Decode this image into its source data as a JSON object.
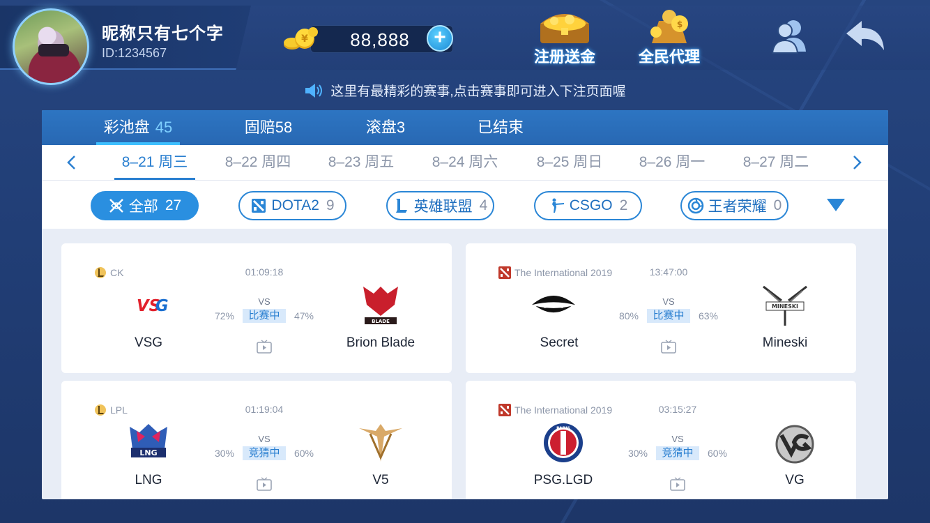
{
  "user": {
    "nickname": "昵称只有七个字",
    "id": "ID:1234567",
    "coins": "88,888"
  },
  "header": {
    "register_bonus_label": "注册送金",
    "agent_label": "全民代理"
  },
  "notice": {
    "text": "这里有最精彩的赛事,点击赛事即可进入下注页面喔"
  },
  "tabs": [
    {
      "label": "彩池盘",
      "count": "45"
    },
    {
      "label": "固赔58",
      "count": ""
    },
    {
      "label": "滚盘3",
      "count": ""
    },
    {
      "label": "已结束",
      "count": ""
    }
  ],
  "dates": [
    "8–21 周三",
    "8–22 周四",
    "8–23 周五",
    "8–24 周六",
    "8–25 周日",
    "8–26 周一",
    "8–27 周二"
  ],
  "games": [
    {
      "label": "全部",
      "count": "27",
      "icon": "crossed-swords-icon"
    },
    {
      "label": "DOTA2",
      "count": "9",
      "icon": "dota2-icon"
    },
    {
      "label": "英雄联盟",
      "count": "4",
      "icon": "lol-icon"
    },
    {
      "label": "CSGO",
      "count": "2",
      "icon": "csgo-icon"
    },
    {
      "label": "王者荣耀",
      "count": "0",
      "icon": "kog-icon"
    }
  ],
  "matches": [
    {
      "league": "CK",
      "game": "lol",
      "time": "01:09:18",
      "vs": "VS",
      "status": "比赛中",
      "home": {
        "name": "VSG",
        "pct": "72%"
      },
      "away": {
        "name": "Brion Blade",
        "pct": "47%"
      }
    },
    {
      "league": "The International 2019",
      "game": "dota2",
      "time": "13:47:00",
      "vs": "VS",
      "status": "比赛中",
      "home": {
        "name": "Secret",
        "pct": "80%"
      },
      "away": {
        "name": "Mineski",
        "pct": "63%"
      }
    },
    {
      "league": "LPL",
      "game": "lol",
      "time": "01:19:04",
      "vs": "VS",
      "status": "竞猜中",
      "home": {
        "name": "LNG",
        "pct": "30%"
      },
      "away": {
        "name": "V5",
        "pct": "60%"
      }
    },
    {
      "league": "The International 2019",
      "game": "dota2",
      "time": "03:15:27",
      "vs": "VS",
      "status": "竞猜中",
      "home": {
        "name": "PSG.LGD",
        "pct": "30%"
      },
      "away": {
        "name": "VG",
        "pct": "60%"
      }
    }
  ],
  "colors": {
    "accent": "#2a7fd0",
    "tabbar": "#2d75c2",
    "status_bg": "#d8e9fb"
  }
}
